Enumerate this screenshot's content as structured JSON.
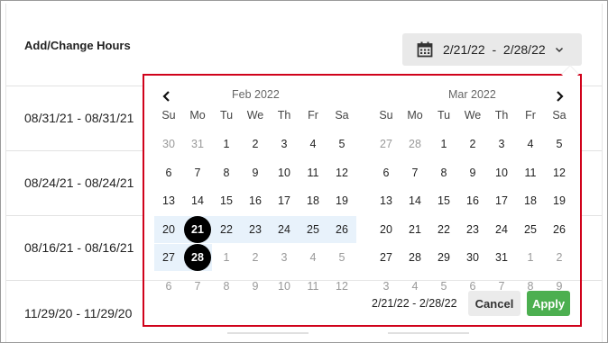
{
  "header": {
    "title": "Add/Change Hours",
    "date_range_button": "2/21/22  -  2/28/22"
  },
  "rows": [
    "08/31/21 - 08/31/21",
    "08/24/21 - 08/24/21",
    "08/16/21 - 08/16/21",
    "11/29/20 - 11/29/20"
  ],
  "calendar": {
    "weekdays": [
      "Su",
      "Mo",
      "Tu",
      "We",
      "Th",
      "Fr",
      "Sa"
    ],
    "months": [
      {
        "title": "Feb 2022",
        "weeks": [
          [
            "30",
            "31",
            "1",
            "2",
            "3",
            "4",
            "5"
          ],
          [
            "6",
            "7",
            "8",
            "9",
            "10",
            "11",
            "12"
          ],
          [
            "13",
            "14",
            "15",
            "16",
            "17",
            "18",
            "19"
          ],
          [
            "20",
            "21",
            "22",
            "23",
            "24",
            "25",
            "26"
          ],
          [
            "27",
            "28",
            "1",
            "2",
            "3",
            "4",
            "5"
          ],
          [
            "6",
            "7",
            "8",
            "9",
            "10",
            "11",
            "12"
          ]
        ],
        "muted": [
          [
            0,
            0
          ],
          [
            0,
            1
          ],
          [
            4,
            2
          ],
          [
            4,
            3
          ],
          [
            4,
            4
          ],
          [
            4,
            5
          ],
          [
            4,
            6
          ],
          [
            5,
            0
          ],
          [
            5,
            1
          ],
          [
            5,
            2
          ],
          [
            5,
            3
          ],
          [
            5,
            4
          ],
          [
            5,
            5
          ],
          [
            5,
            6
          ]
        ],
        "in_range": [
          [
            3,
            0
          ],
          [
            3,
            1
          ],
          [
            3,
            2
          ],
          [
            3,
            3
          ],
          [
            3,
            4
          ],
          [
            3,
            5
          ],
          [
            3,
            6
          ],
          [
            4,
            0
          ],
          [
            4,
            1
          ]
        ],
        "selected": [
          [
            3,
            1
          ],
          [
            4,
            1
          ]
        ]
      },
      {
        "title": "Mar 2022",
        "weeks": [
          [
            "27",
            "28",
            "1",
            "2",
            "3",
            "4",
            "5"
          ],
          [
            "6",
            "7",
            "8",
            "9",
            "10",
            "11",
            "12"
          ],
          [
            "13",
            "14",
            "15",
            "16",
            "17",
            "18",
            "19"
          ],
          [
            "20",
            "21",
            "22",
            "23",
            "24",
            "25",
            "26"
          ],
          [
            "27",
            "28",
            "29",
            "30",
            "31",
            "1",
            "2"
          ],
          [
            "3",
            "4",
            "5",
            "6",
            "7",
            "8",
            "9"
          ]
        ],
        "muted": [
          [
            0,
            0
          ],
          [
            0,
            1
          ],
          [
            4,
            5
          ],
          [
            4,
            6
          ],
          [
            5,
            0
          ],
          [
            5,
            1
          ],
          [
            5,
            2
          ],
          [
            5,
            3
          ],
          [
            5,
            4
          ],
          [
            5,
            5
          ],
          [
            5,
            6
          ]
        ],
        "in_range": [],
        "selected": []
      }
    ],
    "range_text": "2/21/22 - 2/28/22",
    "cancel_label": "Cancel",
    "apply_label": "Apply",
    "apply_color": "#4caf50",
    "range_color": "#e8f2fb",
    "highlight_border_color": "#d0021b"
  }
}
